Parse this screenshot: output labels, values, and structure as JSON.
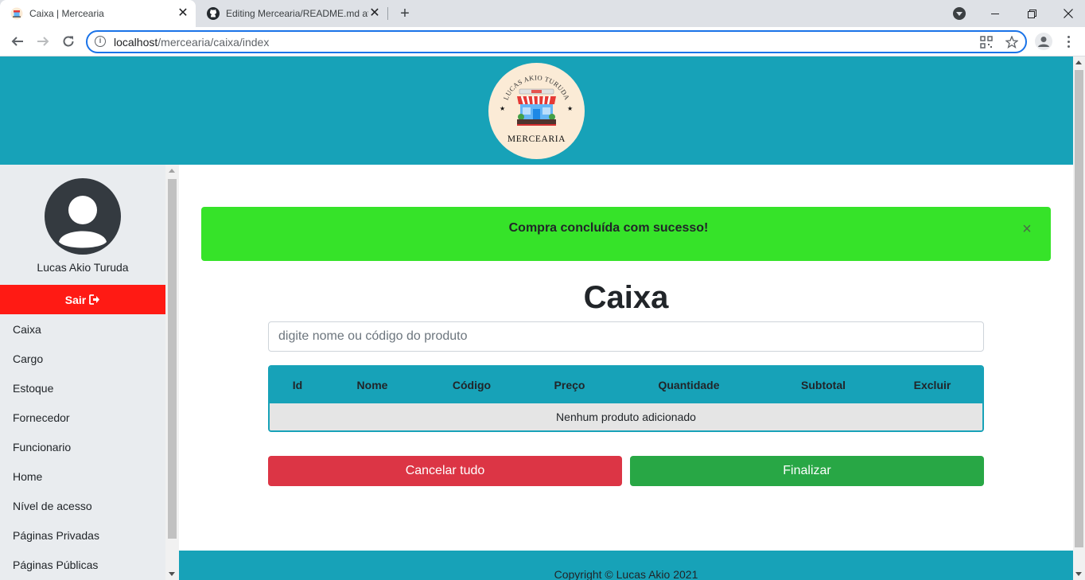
{
  "browser": {
    "tabs": [
      {
        "title": "Caixa | Mercearia",
        "active": true
      },
      {
        "title": "Editing Mercearia/README.md at",
        "active": false
      }
    ],
    "url_host": "localhost",
    "url_path": "/mercearia/caixa/index"
  },
  "header": {
    "logo_top_text": "LUCAS AKIO TURUDA",
    "logo_bottom_text": "MERCEARIA"
  },
  "sidebar": {
    "user_name": "Lucas Akio Turuda",
    "logout_label": "Sair",
    "items": [
      {
        "label": "Caixa"
      },
      {
        "label": "Cargo"
      },
      {
        "label": "Estoque"
      },
      {
        "label": "Fornecedor"
      },
      {
        "label": "Funcionario"
      },
      {
        "label": "Home"
      },
      {
        "label": "Nível de acesso"
      },
      {
        "label": "Páginas Privadas"
      },
      {
        "label": "Páginas Públicas"
      }
    ]
  },
  "alert": {
    "message": "Compra concluída com sucesso!",
    "close": "×"
  },
  "main": {
    "title": "Caixa",
    "search_placeholder": "digite nome ou código do produto",
    "table": {
      "columns": [
        "Id",
        "Nome",
        "Código",
        "Preço",
        "Quantidade",
        "Subtotal",
        "Excluir"
      ],
      "empty_message": "Nenhum produto adicionado"
    },
    "cancel_label": "Cancelar tudo",
    "finish_label": "Finalizar"
  },
  "footer": {
    "text": "Copyright © Lucas Akio 2021"
  },
  "colors": {
    "brand": "#17a2b8",
    "success_alert": "#36e329",
    "logout": "#ff1a14",
    "danger": "#dc3545",
    "success": "#28a745"
  }
}
